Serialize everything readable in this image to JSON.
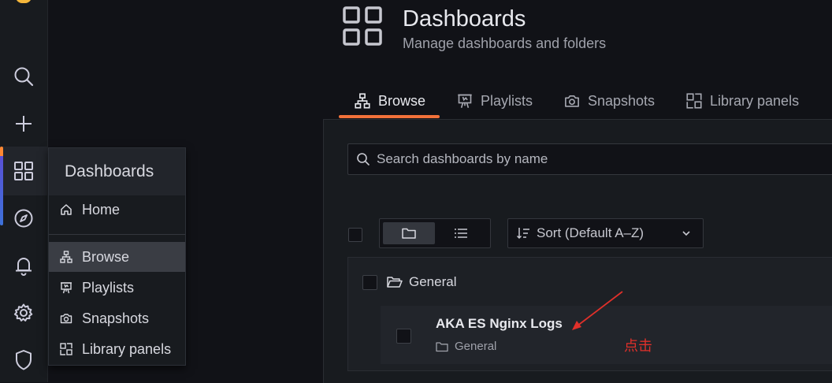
{
  "rail": {
    "accent_colors": [
      "#ff8833",
      "#5a50d6",
      "#3d71d9"
    ],
    "icons": [
      "grafana-logo-icon",
      "search-icon",
      "plus-icon",
      "dashboards-grid-icon",
      "explore-compass-icon",
      "alerting-bell-icon",
      "settings-gear-icon",
      "server-admin-shield-icon"
    ]
  },
  "flyout": {
    "title": "Dashboards",
    "items": [
      {
        "label": "Home",
        "icon": "home-icon"
      },
      {
        "label": "Browse",
        "icon": "sitemap-icon",
        "selected": true
      },
      {
        "label": "Playlists",
        "icon": "presentation-icon"
      },
      {
        "label": "Snapshots",
        "icon": "camera-icon"
      },
      {
        "label": "Library panels",
        "icon": "library-panel-icon"
      }
    ]
  },
  "header": {
    "title": "Dashboards",
    "subtitle": "Manage dashboards and folders"
  },
  "tabs": [
    {
      "label": "Browse",
      "icon": "sitemap-icon",
      "active": true
    },
    {
      "label": "Playlists",
      "icon": "presentation-icon"
    },
    {
      "label": "Snapshots",
      "icon": "camera-icon"
    },
    {
      "label": "Library panels",
      "icon": "library-panel-icon"
    }
  ],
  "tab_accent_color": "#f2713a",
  "search": {
    "placeholder": "Search dashboards by name",
    "value": ""
  },
  "view_toggle": {
    "options": [
      "folder-view-icon",
      "list-view-icon"
    ],
    "selected": "folder-view-icon"
  },
  "sort": {
    "label": "Sort (Default A–Z)"
  },
  "folder": {
    "name": "General"
  },
  "dashboard": {
    "title": "AKA ES Nginx Logs",
    "folder": "General"
  },
  "annotation": {
    "text": "点击",
    "color": "#e0302a"
  }
}
